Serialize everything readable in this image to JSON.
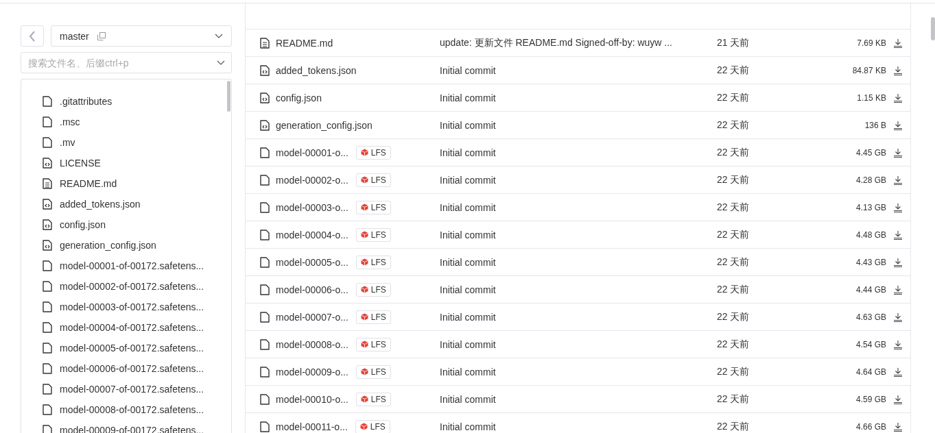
{
  "branch": {
    "name": "master"
  },
  "search": {
    "placeholder": "搜索文件名、后缀ctrl+p"
  },
  "tree": [
    {
      "name": ".gitattributes",
      "kind": "file"
    },
    {
      "name": ".msc",
      "kind": "file"
    },
    {
      "name": ".mv",
      "kind": "file"
    },
    {
      "name": "LICENSE",
      "kind": "code"
    },
    {
      "name": "README.md",
      "kind": "doc"
    },
    {
      "name": "added_tokens.json",
      "kind": "code"
    },
    {
      "name": "config.json",
      "kind": "code"
    },
    {
      "name": "generation_config.json",
      "kind": "code"
    },
    {
      "name": "model-00001-of-00172.safetens...",
      "kind": "file"
    },
    {
      "name": "model-00002-of-00172.safetens...",
      "kind": "file"
    },
    {
      "name": "model-00003-of-00172.safetens...",
      "kind": "file"
    },
    {
      "name": "model-00004-of-00172.safetens...",
      "kind": "file"
    },
    {
      "name": "model-00005-of-00172.safetens...",
      "kind": "file"
    },
    {
      "name": "model-00006-of-00172.safetens...",
      "kind": "file"
    },
    {
      "name": "model-00007-of-00172.safetens...",
      "kind": "file"
    },
    {
      "name": "model-00008-of-00172.safetens...",
      "kind": "file"
    },
    {
      "name": "model-00009-of-00172.safetens...",
      "kind": "file"
    }
  ],
  "table": {
    "rows": [
      {
        "kind": "doc",
        "name": "README.md",
        "lfs": false,
        "commit": "update: 更新文件 README.md Signed-off-by: wuyw ...",
        "time": "21 天前",
        "size": "7.69 KB"
      },
      {
        "kind": "code",
        "name": "added_tokens.json",
        "lfs": false,
        "commit": "Initial commit",
        "time": "22 天前",
        "size": "84.87 KB"
      },
      {
        "kind": "code",
        "name": "config.json",
        "lfs": false,
        "commit": "Initial commit",
        "time": "22 天前",
        "size": "1.15 KB"
      },
      {
        "kind": "code",
        "name": "generation_config.json",
        "lfs": false,
        "commit": "Initial commit",
        "time": "22 天前",
        "size": "136 B"
      },
      {
        "kind": "file",
        "name": "model-00001-o...",
        "lfs": true,
        "lfs_label": "LFS",
        "commit": "Initial commit",
        "time": "22 天前",
        "size": "4.45 GB"
      },
      {
        "kind": "file",
        "name": "model-00002-o...",
        "lfs": true,
        "lfs_label": "LFS",
        "commit": "Initial commit",
        "time": "22 天前",
        "size": "4.28 GB"
      },
      {
        "kind": "file",
        "name": "model-00003-o...",
        "lfs": true,
        "lfs_label": "LFS",
        "commit": "Initial commit",
        "time": "22 天前",
        "size": "4.13 GB"
      },
      {
        "kind": "file",
        "name": "model-00004-o...",
        "lfs": true,
        "lfs_label": "LFS",
        "commit": "Initial commit",
        "time": "22 天前",
        "size": "4.48 GB"
      },
      {
        "kind": "file",
        "name": "model-00005-o...",
        "lfs": true,
        "lfs_label": "LFS",
        "commit": "Initial commit",
        "time": "22 天前",
        "size": "4.43 GB"
      },
      {
        "kind": "file",
        "name": "model-00006-o...",
        "lfs": true,
        "lfs_label": "LFS",
        "commit": "Initial commit",
        "time": "22 天前",
        "size": "4.44 GB"
      },
      {
        "kind": "file",
        "name": "model-00007-o...",
        "lfs": true,
        "lfs_label": "LFS",
        "commit": "Initial commit",
        "time": "22 天前",
        "size": "4.63 GB"
      },
      {
        "kind": "file",
        "name": "model-00008-o...",
        "lfs": true,
        "lfs_label": "LFS",
        "commit": "Initial commit",
        "time": "22 天前",
        "size": "4.54 GB"
      },
      {
        "kind": "file",
        "name": "model-00009-o...",
        "lfs": true,
        "lfs_label": "LFS",
        "commit": "Initial commit",
        "time": "22 天前",
        "size": "4.64 GB"
      },
      {
        "kind": "file",
        "name": "model-00010-o...",
        "lfs": true,
        "lfs_label": "LFS",
        "commit": "Initial commit",
        "time": "22 天前",
        "size": "4.59 GB"
      },
      {
        "kind": "file",
        "name": "model-00011-o...",
        "lfs": true,
        "lfs_label": "LFS",
        "commit": "Initial commit",
        "time": "22 天前",
        "size": "4.66 GB"
      }
    ]
  }
}
